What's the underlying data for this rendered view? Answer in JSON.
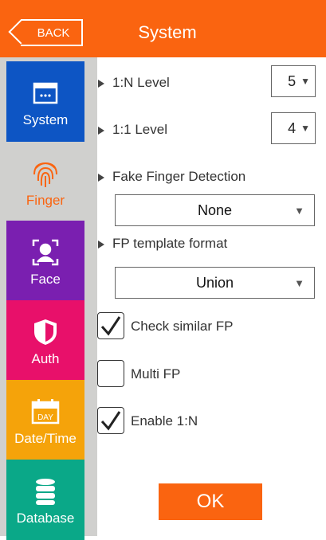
{
  "header": {
    "back_label": "BACK",
    "title": "System"
  },
  "sidebar": {
    "items": [
      {
        "label": "System",
        "icon": "system-icon",
        "color": "#0d55c4"
      },
      {
        "label": "Finger",
        "icon": "fingerprint-icon",
        "color": "#fa6410",
        "active": true
      },
      {
        "label": "Face",
        "icon": "face-icon",
        "color": "#7a1fb0"
      },
      {
        "label": "Auth",
        "icon": "shield-icon",
        "color": "#e8106a"
      },
      {
        "label": "Date/Time",
        "icon": "calendar-icon",
        "color": "#f5a30a",
        "day_text": "DAY"
      },
      {
        "label": "Database",
        "icon": "database-icon",
        "color": "#0aa888"
      }
    ]
  },
  "settings": {
    "n_level": {
      "label": "1:N Level",
      "value": "5"
    },
    "one_level": {
      "label": "1:1 Level",
      "value": "4"
    },
    "fake_finger": {
      "label": "Fake Finger Detection",
      "value": "None"
    },
    "fp_template": {
      "label": "FP template format",
      "value": "Union"
    },
    "check_similar": {
      "label": "Check similar FP",
      "checked": true
    },
    "multi_fp": {
      "label": "Multi FP",
      "checked": false
    },
    "enable_1n": {
      "label": "Enable 1:N",
      "checked": true
    }
  },
  "ok_label": "OK"
}
